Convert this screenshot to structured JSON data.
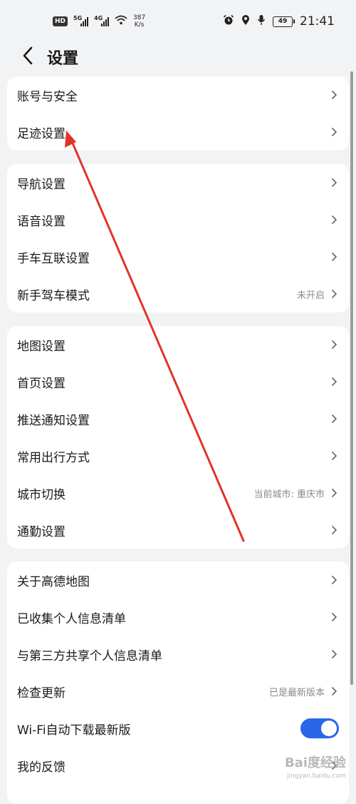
{
  "status_bar": {
    "hd_badge": "HD",
    "sim1_gen": "5G",
    "sim2_gen": "4G",
    "speed_value": "387",
    "speed_unit": "K/s",
    "battery_level": "49",
    "time": "21:41",
    "icons": [
      "alarm-icon",
      "location-icon",
      "mic-icon"
    ]
  },
  "header": {
    "title": "设置",
    "back_icon": "chevron-left-icon"
  },
  "groups": [
    {
      "rows": [
        {
          "label": "账号与安全"
        },
        {
          "label": "足迹设置"
        }
      ]
    },
    {
      "rows": [
        {
          "label": "导航设置"
        },
        {
          "label": "语音设置"
        },
        {
          "label": "手车互联设置"
        },
        {
          "label": "新手驾车模式",
          "value": "未开启"
        }
      ]
    },
    {
      "rows": [
        {
          "label": "地图设置"
        },
        {
          "label": "首页设置"
        },
        {
          "label": "推送通知设置"
        },
        {
          "label": "常用出行方式"
        },
        {
          "label": "城市切换",
          "value": "当前城市: 重庆市"
        },
        {
          "label": "通勤设置"
        }
      ]
    },
    {
      "rows": [
        {
          "label": "关于高德地图"
        },
        {
          "label": "已收集个人信息清单"
        },
        {
          "label": "与第三方共享个人信息清单"
        },
        {
          "label": "检查更新",
          "value": "已是最新版本"
        },
        {
          "label": "Wi-Fi自动下载最新版",
          "toggle": true
        },
        {
          "label": "我的反馈"
        }
      ]
    }
  ],
  "colors": {
    "toggle_on": "#2a66e8",
    "annotation_arrow": "#e0342a",
    "background": "#f2f3f5"
  },
  "watermark": {
    "main": "Bai度经验",
    "sub": "jingyan.baidu.com"
  }
}
